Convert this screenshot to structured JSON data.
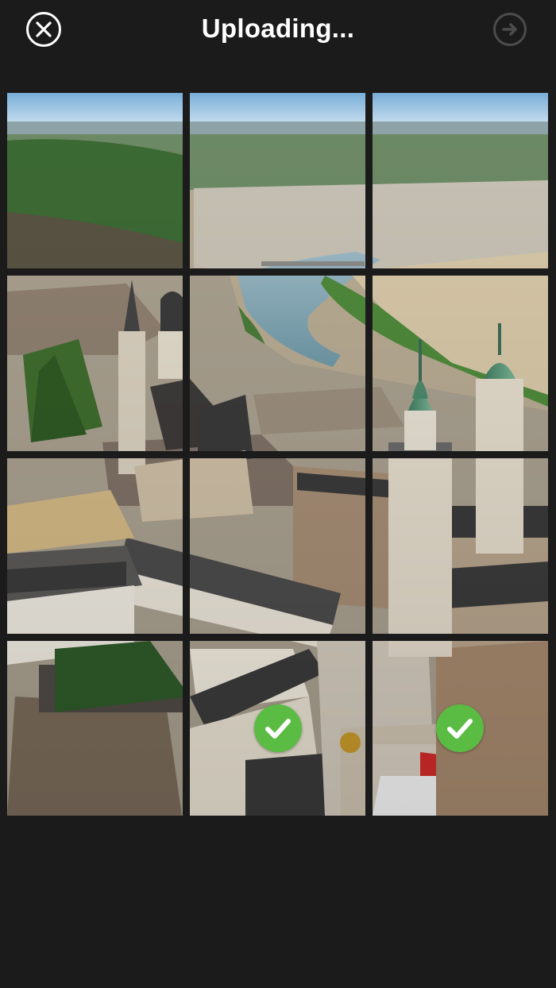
{
  "header": {
    "title": "Uploading...",
    "close_icon": "close-circle-icon",
    "next_icon": "arrow-right-circle-icon"
  },
  "grid": {
    "rows": 4,
    "columns": 3,
    "tiles": [
      {
        "row": 1,
        "column": 1,
        "uploaded": false
      },
      {
        "row": 1,
        "column": 2,
        "uploaded": false
      },
      {
        "row": 1,
        "column": 3,
        "uploaded": false
      },
      {
        "row": 2,
        "column": 1,
        "uploaded": false
      },
      {
        "row": 2,
        "column": 2,
        "uploaded": false
      },
      {
        "row": 2,
        "column": 3,
        "uploaded": false
      },
      {
        "row": 3,
        "column": 1,
        "uploaded": false
      },
      {
        "row": 3,
        "column": 2,
        "uploaded": false
      },
      {
        "row": 3,
        "column": 3,
        "uploaded": false
      },
      {
        "row": 4,
        "column": 1,
        "uploaded": false
      },
      {
        "row": 4,
        "column": 2,
        "uploaded": true
      },
      {
        "row": 4,
        "column": 3,
        "uploaded": true
      }
    ],
    "check_icon": "checkmark-icon"
  },
  "colors": {
    "background": "#1b1b1b",
    "check_green": "#5bbc44",
    "next_disabled": "#4c4c4c"
  }
}
